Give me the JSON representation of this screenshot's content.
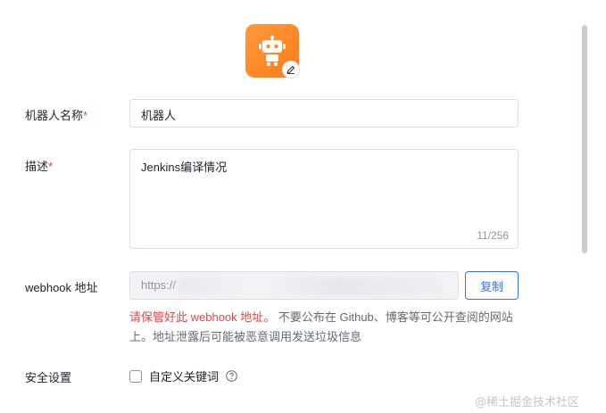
{
  "form": {
    "name_label": "机器人名称",
    "name_required": "*",
    "name_value": "机器人",
    "desc_label": "描述",
    "desc_required": "*",
    "desc_value": "Jenkins编译情况",
    "desc_counter": "11/256",
    "webhook_label": "webhook 地址",
    "webhook_value": "https://",
    "copy_label": "复制",
    "warning_red": "请保管好此 webhook 地址。",
    "warning_rest": " 不要公布在 Github、博客等可公开查阅的网站上。地址泄露后可能被恶意调用发送垃圾信息",
    "security_label": "安全设置",
    "keyword_label": "自定义关键词"
  },
  "icons": {
    "avatar": "robot-icon",
    "edit": "pencil-icon",
    "help": "question-circle-icon"
  },
  "colors": {
    "accent": "#3370ff",
    "danger": "#e54545",
    "avatar": "#ff7a1a"
  },
  "watermark": "@稀土掘金技术社区"
}
